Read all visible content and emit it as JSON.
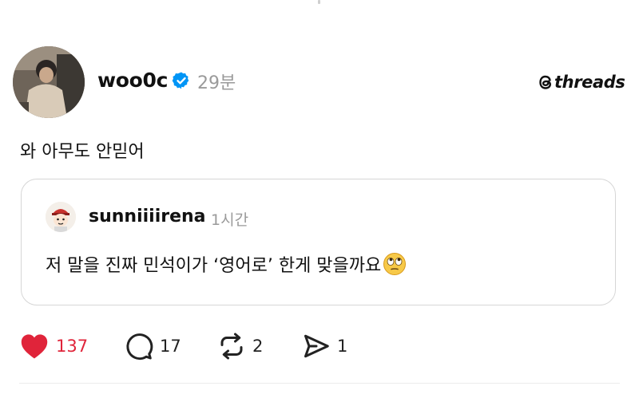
{
  "post": {
    "username": "woo0c",
    "time": "29분",
    "text": "와 아무도 안믿어",
    "verified": true
  },
  "brand": {
    "name": "threads"
  },
  "quote": {
    "username": "sunniiiirena",
    "time": "1시간",
    "text": "저 말을 진짜 민석이가 ‘영어로’ 한게 맞을까요",
    "emoji": "face-with-rolling-eyes"
  },
  "actions": {
    "like_count": "137",
    "reply_count": "17",
    "repost_count": "2",
    "share_count": "1"
  },
  "colors": {
    "like": "#e0243a",
    "verified": "#0095f6",
    "muted": "#9a9a9a"
  }
}
